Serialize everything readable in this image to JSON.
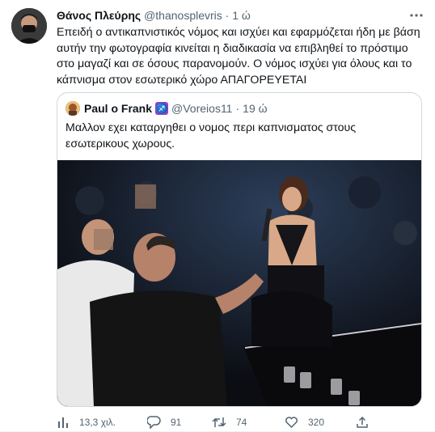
{
  "tweet": {
    "display_name": "Θάνος Πλεύρης",
    "handle": "@thanosplevris",
    "separator": "·",
    "time": "1 ώ",
    "text": "Επειδή ο αντικαπνιστικός νόμος και ισχύει και εφαρμόζεται ήδη με βάση αυτήν την φωτογραφία κινείται η διαδικασία να επιβληθεί το πρόστιμο στο μαγαζί και σε όσους παρανομούν. Ο νόμος ισχύει για όλους και το κάπνισμα στον εσωτερικό χώρο ΑΠΑΓΟΡΕΥΕΤΑΙ"
  },
  "quoted": {
    "display_name": "Paul o Frank",
    "zodiac_glyph": "♐",
    "handle": "@Voreios11",
    "separator": "·",
    "time": "19 ώ",
    "text": "Μαλλον εχει καταργηθει ο νομος περι καπνισματος στους εσωτερικους χωρους."
  },
  "actions": {
    "views": "13,3 χιλ.",
    "replies": "91",
    "retweets": "74",
    "likes": "320"
  },
  "icons": [
    "avatar",
    "more-icon",
    "zodiac-sagittarius-icon",
    "analytics-icon",
    "reply-icon",
    "retweet-icon",
    "like-icon",
    "share-icon"
  ],
  "colors": {
    "text": "#0f1419",
    "muted": "#536471",
    "border": "#cfd9de",
    "zodiac": "#8d45c2"
  }
}
